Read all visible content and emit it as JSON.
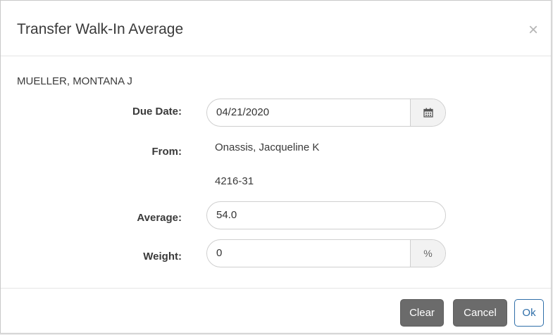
{
  "dialog": {
    "title": "Transfer Walk-In Average",
    "close_glyph": "×"
  },
  "student": {
    "name": "MUELLER, MONTANA J"
  },
  "form": {
    "due_date": {
      "label": "Due Date:",
      "value": "04/21/2020",
      "icon": "calendar-icon"
    },
    "from": {
      "label": "From:",
      "teacher": "Onassis, Jacqueline K",
      "course_section": "4216-31"
    },
    "average": {
      "label": "Average:",
      "value": "54.0"
    },
    "weight": {
      "label": "Weight:",
      "value": "0",
      "unit": "%"
    }
  },
  "buttons": {
    "clear": "Clear",
    "cancel": "Cancel",
    "ok": "Ok"
  },
  "colors": {
    "button_dark": "#6b6b6b",
    "ok_accent": "#2f6fa9"
  }
}
